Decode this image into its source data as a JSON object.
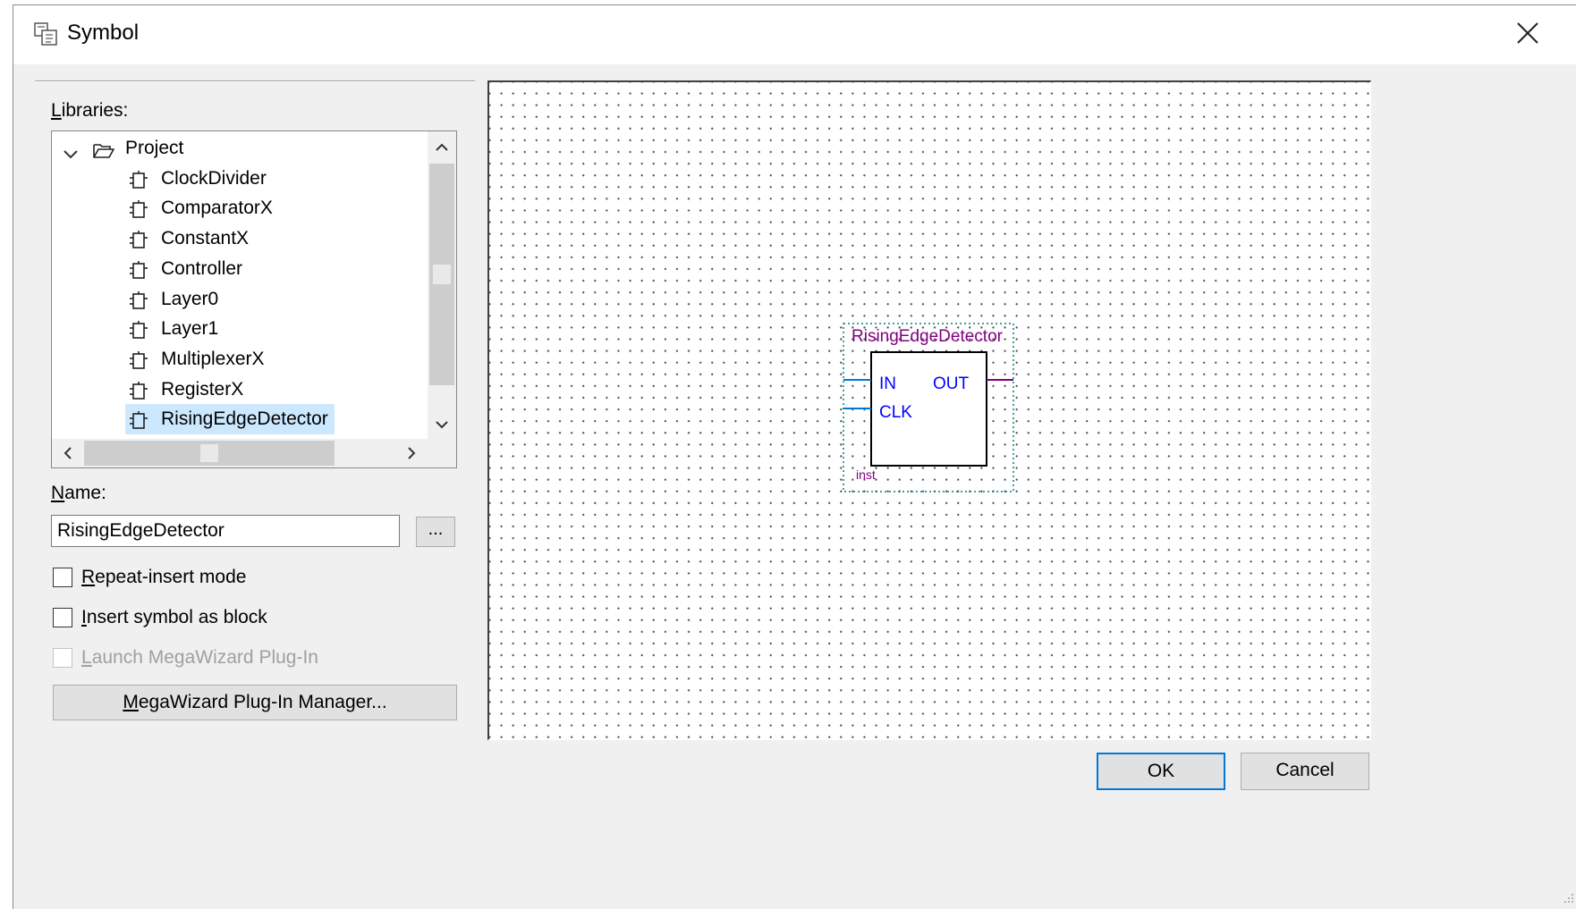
{
  "window": {
    "title": "Symbol",
    "icon": "symbol-dialog-icon",
    "close_icon": "close-icon"
  },
  "libraries": {
    "label_accel": "L",
    "label_rest": "ibraries:",
    "tree": {
      "root": {
        "label": "Project",
        "expanded": true,
        "icon": "open-folder-icon",
        "expander_icon": "chevron-down-icon"
      },
      "items": [
        {
          "label": "ClockDivider"
        },
        {
          "label": "ComparatorX"
        },
        {
          "label": "ConstantX"
        },
        {
          "label": "Controller"
        },
        {
          "label": "Layer0"
        },
        {
          "label": "Layer1"
        },
        {
          "label": "MultiplexerX"
        },
        {
          "label": "RegisterX"
        },
        {
          "label": "RisingEdgeDetector",
          "selected": true
        }
      ],
      "item_icon": "symbol-file-icon"
    }
  },
  "name": {
    "label_accel": "N",
    "label_rest": "ame:",
    "value": "RisingEdgeDetector",
    "browse_label": "..."
  },
  "options": {
    "repeat_insert": {
      "accel": "R",
      "rest": "epeat-insert mode",
      "checked": false,
      "enabled": true
    },
    "insert_as_block": {
      "accel": "I",
      "rest": "nsert symbol as block",
      "checked": false,
      "enabled": true
    },
    "launch_megawizard": {
      "accel": "L",
      "rest": "aunch MegaWizard Plug-In",
      "checked": false,
      "enabled": false
    }
  },
  "megawizard_button": {
    "accel": "M",
    "rest": "egaWizard Plug-In Manager..."
  },
  "preview": {
    "symbol_name": "RisingEdgeDetector",
    "instance_name": "inst",
    "ports": {
      "inputs": [
        "IN",
        "CLK"
      ],
      "outputs": [
        "OUT"
      ]
    },
    "colors": {
      "symbol_name": "#800080",
      "instance": "#800080",
      "input_port": "#0000ff",
      "output_port": "#800080",
      "input_wire": "#0078d7",
      "output_wire": "#800080",
      "bounding_dots": "#008080"
    }
  },
  "buttons": {
    "ok": "OK",
    "cancel": "Cancel"
  }
}
